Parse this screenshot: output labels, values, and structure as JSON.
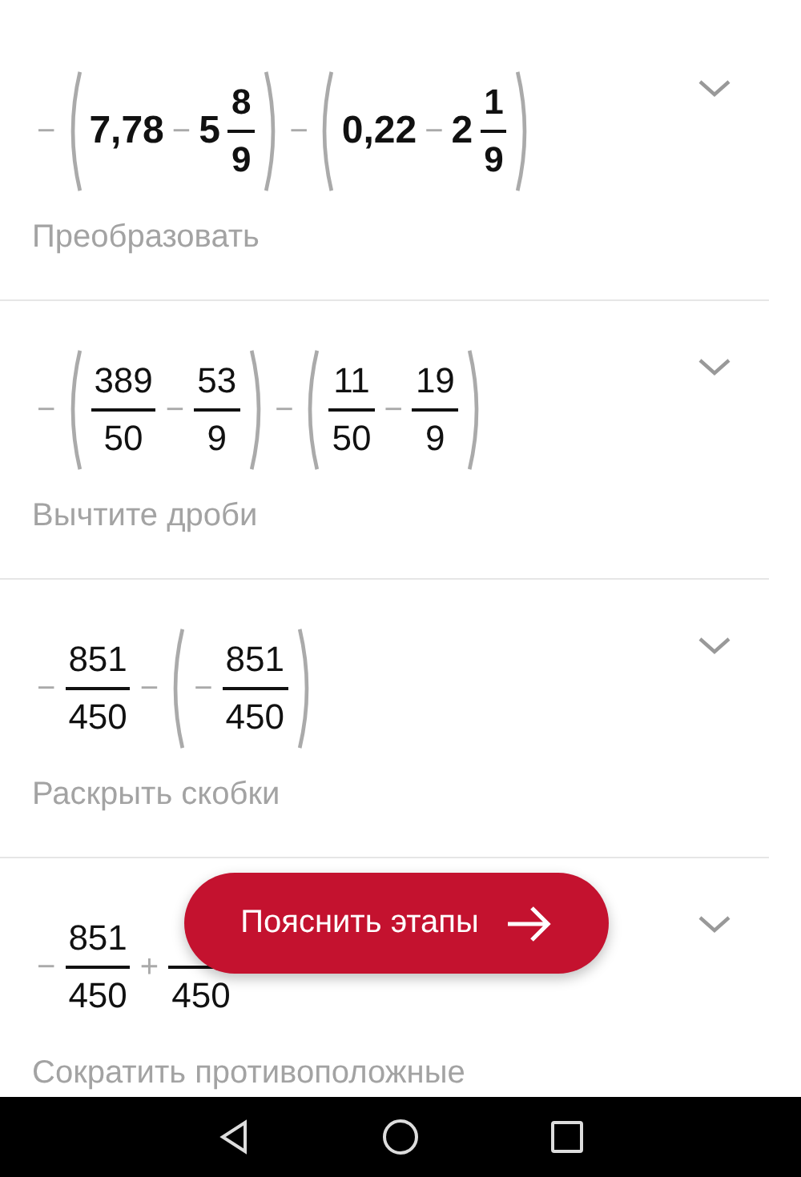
{
  "steps": [
    {
      "bold": true,
      "expanded": false,
      "description": "Преобразовать",
      "expression": [
        {
          "kind": "op",
          "text": "−"
        },
        {
          "kind": "group",
          "items": [
            {
              "kind": "num",
              "text": "7,78"
            },
            {
              "kind": "op",
              "text": "−"
            },
            {
              "kind": "num",
              "text": "5"
            },
            {
              "kind": "frac",
              "num": "8",
              "den": "9"
            }
          ]
        },
        {
          "kind": "op",
          "text": "−"
        },
        {
          "kind": "group",
          "items": [
            {
              "kind": "num",
              "text": "0,22"
            },
            {
              "kind": "op",
              "text": "−"
            },
            {
              "kind": "num",
              "text": "2"
            },
            {
              "kind": "frac",
              "num": "1",
              "den": "9"
            }
          ]
        }
      ]
    },
    {
      "bold": false,
      "expanded": false,
      "description": "Вычтите дроби",
      "expression": [
        {
          "kind": "op",
          "text": "−"
        },
        {
          "kind": "group",
          "items": [
            {
              "kind": "frac",
              "num": "389",
              "den": "50"
            },
            {
              "kind": "op",
              "text": "−"
            },
            {
              "kind": "frac",
              "num": "53",
              "den": "9"
            }
          ]
        },
        {
          "kind": "op",
          "text": "−"
        },
        {
          "kind": "group",
          "items": [
            {
              "kind": "frac",
              "num": "11",
              "den": "50"
            },
            {
              "kind": "op",
              "text": "−"
            },
            {
              "kind": "frac",
              "num": "19",
              "den": "9"
            }
          ]
        }
      ]
    },
    {
      "bold": false,
      "expanded": false,
      "description": "Раскрыть скобки",
      "expression": [
        {
          "kind": "op",
          "text": "−"
        },
        {
          "kind": "frac",
          "num": "851",
          "den": "450"
        },
        {
          "kind": "op",
          "text": "−"
        },
        {
          "kind": "group",
          "items": [
            {
              "kind": "op",
              "text": "−"
            },
            {
              "kind": "frac",
              "num": "851",
              "den": "450"
            }
          ]
        }
      ]
    },
    {
      "bold": false,
      "expanded": false,
      "description": "Сократить противоположные",
      "expression": [
        {
          "kind": "op",
          "text": "−"
        },
        {
          "kind": "frac",
          "num": "851",
          "den": "450"
        },
        {
          "kind": "op",
          "text": "+"
        },
        {
          "kind": "frac",
          "den": "450"
        }
      ]
    }
  ],
  "explain_button": {
    "label": "Пояснить этапы"
  }
}
